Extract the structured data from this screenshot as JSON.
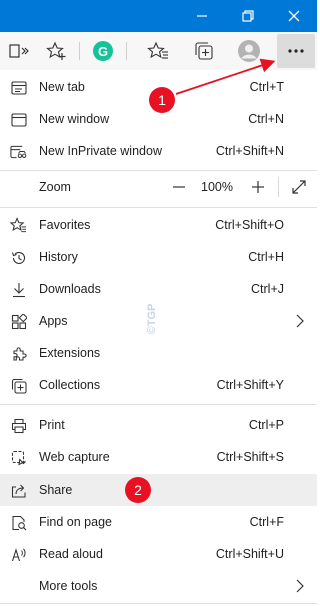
{
  "titlebar": {
    "color": "#0078d7",
    "minimize_glyph": "–",
    "restore_glyph": "❐",
    "close_glyph": "✕"
  },
  "toolbar": {
    "icons": [
      "reading-view-icon",
      "add-favorite-icon",
      "grammarly-icon",
      "favorites-icon",
      "collections-icon",
      "profile-avatar-icon",
      "settings-and-more-icon"
    ],
    "grammarly_letter": "G",
    "more_glyph": "···"
  },
  "menu": {
    "items": [
      {
        "label": "New tab",
        "shortcut": "Ctrl+T",
        "icon": "new-tab-icon"
      },
      {
        "label": "New window",
        "shortcut": "Ctrl+N",
        "icon": "new-window-icon"
      },
      {
        "label": "New InPrivate window",
        "shortcut": "Ctrl+Shift+N",
        "icon": "inprivate-icon"
      },
      {
        "label": "Zoom",
        "icon": ""
      },
      {
        "label": "Favorites",
        "shortcut": "Ctrl+Shift+O",
        "icon": "favorites-icon"
      },
      {
        "label": "History",
        "shortcut": "Ctrl+H",
        "icon": "history-icon"
      },
      {
        "label": "Downloads",
        "shortcut": "Ctrl+J",
        "icon": "downloads-icon"
      },
      {
        "label": "Apps",
        "icon": "apps-icon"
      },
      {
        "label": "Extensions",
        "icon": "extensions-icon"
      },
      {
        "label": "Collections",
        "shortcut": "Ctrl+Shift+Y",
        "icon": "collections-icon"
      },
      {
        "label": "Print",
        "shortcut": "Ctrl+P",
        "icon": "print-icon"
      },
      {
        "label": "Web capture",
        "shortcut": "Ctrl+Shift+S",
        "icon": "web-capture-icon"
      },
      {
        "label": "Share",
        "icon": "share-icon",
        "highlighted": true
      },
      {
        "label": "Find on page",
        "shortcut": "Ctrl+F",
        "icon": "find-icon"
      },
      {
        "label": "Read aloud",
        "shortcut": "Ctrl+Shift+U",
        "icon": "read-aloud-icon"
      },
      {
        "label": "More tools",
        "icon": ""
      }
    ],
    "zoom": {
      "minus": "—",
      "value": "100%",
      "plus": "+"
    }
  },
  "annotations": {
    "badge_1": "1",
    "badge_2": "2",
    "badge_color": "#e81123",
    "arrow_color": "#e81123"
  },
  "watermark": "©TGP"
}
